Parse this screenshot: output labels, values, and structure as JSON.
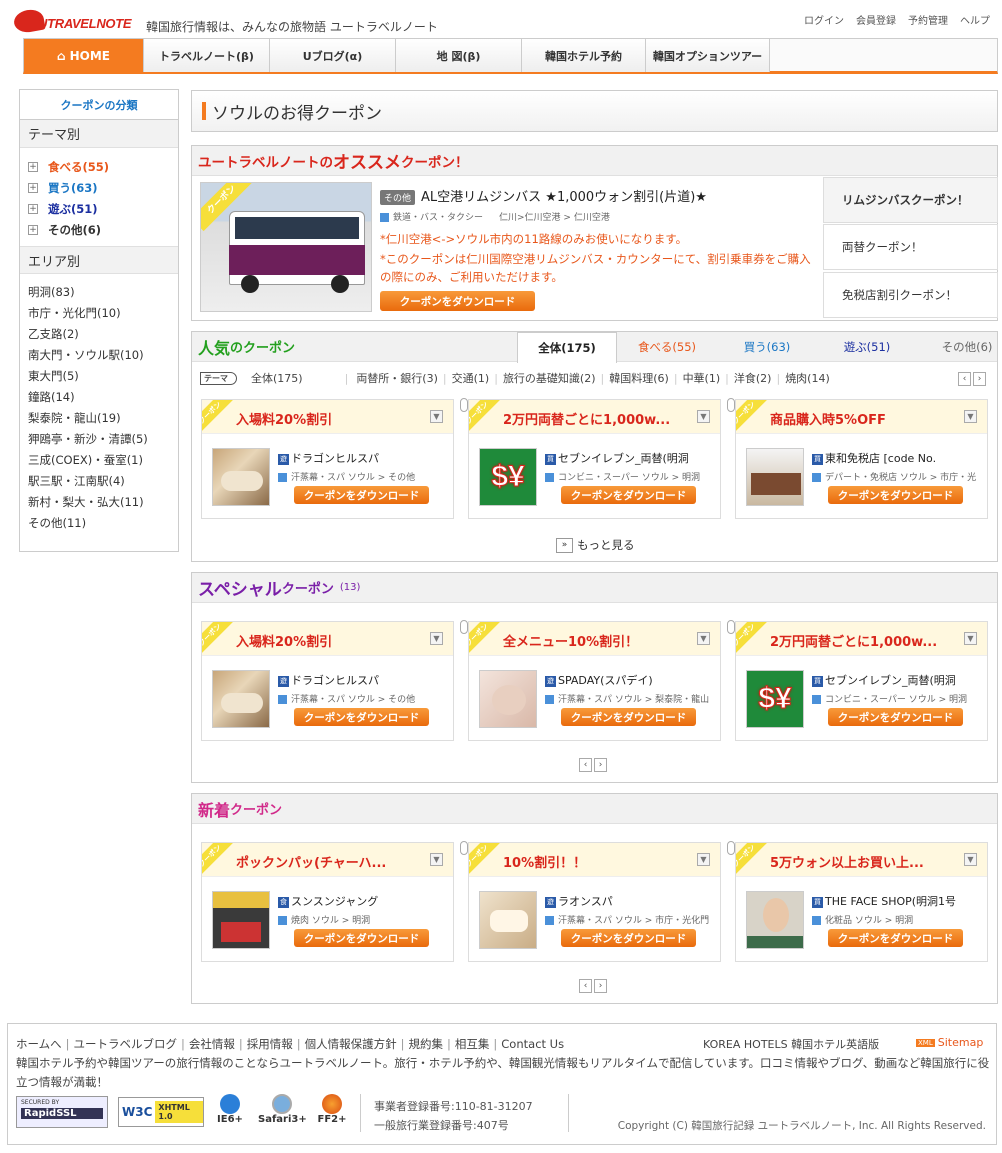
{
  "header": {
    "logo": "UTRAVELNOTE",
    "tagline": "韓国旅行情報は、みんなの旅物語 ユートラベルノート",
    "toplinks": [
      "ログイン",
      "会員登録",
      "予約管理",
      "ヘルプ"
    ]
  },
  "nav": [
    {
      "label": "HOME",
      "on": true
    },
    {
      "label": "トラベルノート(β)"
    },
    {
      "label": "Uブログ(α)"
    },
    {
      "label": "地 図(β)"
    },
    {
      "label": "韓国ホテル予約"
    },
    {
      "label": "韓国オプションツアー"
    }
  ],
  "sidebar": {
    "title": "クーポンの分類",
    "theme_title": "テーマ別",
    "themes": [
      {
        "label": "食べる(55)",
        "color": "#e8571b"
      },
      {
        "label": "買う(63)",
        "color": "#1a76c4"
      },
      {
        "label": "遊ぶ(51)",
        "color": "#1b2fa0"
      },
      {
        "label": "その他(6)",
        "color": "#333"
      }
    ],
    "area_title": "エリア別",
    "areas": [
      "明洞(83)",
      "市庁・光化門(10)",
      "乙支路(2)",
      "南大門・ソウル駅(10)",
      "東大門(5)",
      "鐘路(14)",
      "梨泰院・龍山(19)",
      "狎鴎亭・新沙・清譚(5)",
      "三成(COEX)・蚕室(1)",
      "駅三駅・江南駅(4)",
      "新村・梨大・弘大(11)",
      "その他(11)"
    ]
  },
  "page_title": "ソウルのお得クーポン",
  "recommend": {
    "head_a": "ユートラベルノートの",
    "head_b": "オススメ",
    "head_c": "クーポン！",
    "ribbon": "クーポン",
    "tag": "その他",
    "title": "AL空港リムジンバス ★1,000ウォン割引(片道)★",
    "category": "鉄道・バス・タクシー",
    "area": "仁川>仁川空港 > 仁川空港",
    "note1": "*仁川空港<->ソウル市内の11路線のみお使いになります。",
    "note2": "*このクーポンは仁川国際空港リムジンバス・カウンターにて、割引乗車券をご購入の際にのみ、ご利用いただけます。",
    "download": "クーポンをダウンロード",
    "tabs": [
      "リムジンバスクーポン！",
      "両替クーポン！",
      "免税店割引クーポン！"
    ]
  },
  "popular": {
    "head_a": "人気",
    "head_b": "のクーポン",
    "tabs": [
      {
        "label": "全体(175)",
        "color": "#222"
      },
      {
        "label": "食べる(55)",
        "color": "#e8571b"
      },
      {
        "label": "買う(63)",
        "color": "#1a76c4"
      },
      {
        "label": "遊ぶ(51)",
        "color": "#1b2fa0"
      },
      {
        "label": "その他(6)",
        "color": "#666"
      }
    ],
    "theme_tag": "テーマ",
    "subcats": [
      "全体(175)",
      "両替所・銀行(3)",
      "交通(1)",
      "旅行の基礎知識(2)",
      "韓国料理(6)",
      "中華(1)",
      "洋食(2)",
      "焼肉(14)"
    ],
    "more": "もっと見る",
    "cards": [
      {
        "title": "入場料20%割引",
        "shop": "ドラゴンヒルスパ",
        "kind": "遊",
        "meta": "汗蒸幕・スパ ソウル > その他",
        "thumb": "spa"
      },
      {
        "title": "2万円両替ごとに1,000w...",
        "shop": "セブンイレブン_両替(明洞",
        "kind": "買",
        "meta": "コンビニ・スーパー ソウル > 明洞",
        "thumb": "money"
      },
      {
        "title": "商品購入時5%OFF",
        "shop": "東和免税店 [code No.",
        "kind": "買",
        "meta": "デパート・免税店 ソウル > 市庁・光",
        "thumb": "store"
      }
    ]
  },
  "special": {
    "head_a": "スペシャル",
    "head_b": "クーポン",
    "count": "(13)",
    "cards": [
      {
        "title": "入場料20%割引",
        "shop": "ドラゴンヒルスパ",
        "kind": "遊",
        "meta": "汗蒸幕・スパ ソウル > その他",
        "thumb": "spa"
      },
      {
        "title": "全メニュー10%割引！",
        "shop": "SPADAY(スパデイ)",
        "kind": "遊",
        "meta": "汗蒸幕・スパ ソウル > 梨泰院・龍山",
        "thumb": "massage"
      },
      {
        "title": "2万円両替ごとに1,000w...",
        "shop": "セブンイレブン_両替(明洞",
        "kind": "買",
        "meta": "コンビニ・スーパー ソウル > 明洞",
        "thumb": "money"
      }
    ]
  },
  "newest": {
    "head_a": "新着",
    "head_b": "クーポン",
    "cards": [
      {
        "title": "ポックンパッ(チャーハ...",
        "shop": "スンスンジャング",
        "kind": "食",
        "meta": "焼肉 ソウル > 明洞",
        "thumb": "restaurant"
      },
      {
        "title": "10%割引！！",
        "shop": "ラオンスパ",
        "kind": "遊",
        "meta": "汗蒸幕・スパ ソウル > 市庁・光化門",
        "thumb": "towel"
      },
      {
        "title": "5万ウォン以上お買い上...",
        "shop": "THE FACE SHOP(明洞1号",
        "kind": "買",
        "meta": "化粧品 ソウル > 明洞",
        "thumb": "face"
      }
    ]
  },
  "download": "クーポンをダウンロード",
  "footer": {
    "links": [
      "ホームへ",
      "ユートラベルブログ",
      "会社情報",
      "採用情報",
      "個人情報保護方針",
      "規約集",
      "相互集",
      "Contact Us"
    ],
    "right_link": "KOREA HOTELS 韓国ホテル英語版",
    "xml": "XML",
    "sitemap": "Sitemap",
    "desc": "韓国ホテル予約や韓国ツアーの旅行情報のことならユートラベルノート。旅行・ホテル予約や、韓国観光情報もリアルタイムで配信しています。口コミ情報やブログ、動画など韓国旅行に役立つ情報が満載！",
    "badges": [
      "SECURED BY",
      "RapidSSL",
      "W3C",
      "XHTML 1.0",
      "IE6+",
      "Safari3+",
      "FF2+"
    ],
    "reg1": "事業者登録番号:110-81-31207",
    "reg2": "一般旅行業登録番号:407号",
    "copyright": "Copyright (C) 韓国旅行記録 ユートラベルノート, Inc. All Rights Reserved."
  }
}
